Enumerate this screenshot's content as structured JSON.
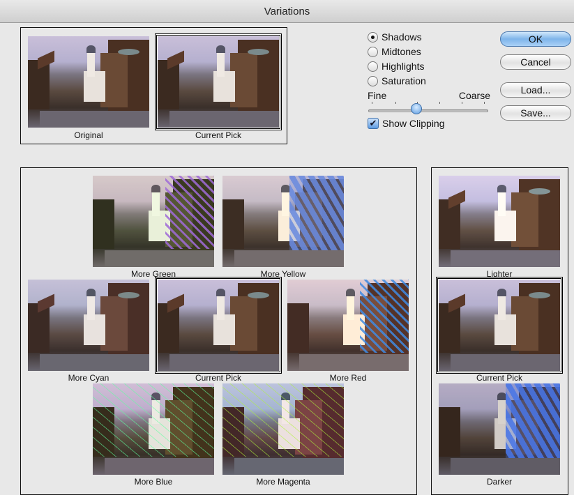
{
  "window": {
    "title": "Variations"
  },
  "top": {
    "original_caption": "Original",
    "current_pick_caption": "Current Pick"
  },
  "options": {
    "radios": [
      {
        "label": "Shadows",
        "selected": true
      },
      {
        "label": "Midtones",
        "selected": false
      },
      {
        "label": "Highlights",
        "selected": false
      },
      {
        "label": "Saturation",
        "selected": false
      }
    ],
    "slider": {
      "left_label": "Fine",
      "right_label": "Coarse",
      "position": 0.4
    },
    "show_clipping": {
      "label": "Show Clipping",
      "checked": true
    }
  },
  "buttons": {
    "ok": "OK",
    "cancel": "Cancel",
    "load": "Load...",
    "save": "Save..."
  },
  "color_panel": {
    "more_green": "More Green",
    "more_yellow": "More Yellow",
    "more_cyan": "More Cyan",
    "current_pick": "Current Pick",
    "more_red": "More Red",
    "more_blue": "More Blue",
    "more_magenta": "More Magenta"
  },
  "brightness_panel": {
    "lighter": "Lighter",
    "current_pick": "Current Pick",
    "darker": "Darker"
  }
}
